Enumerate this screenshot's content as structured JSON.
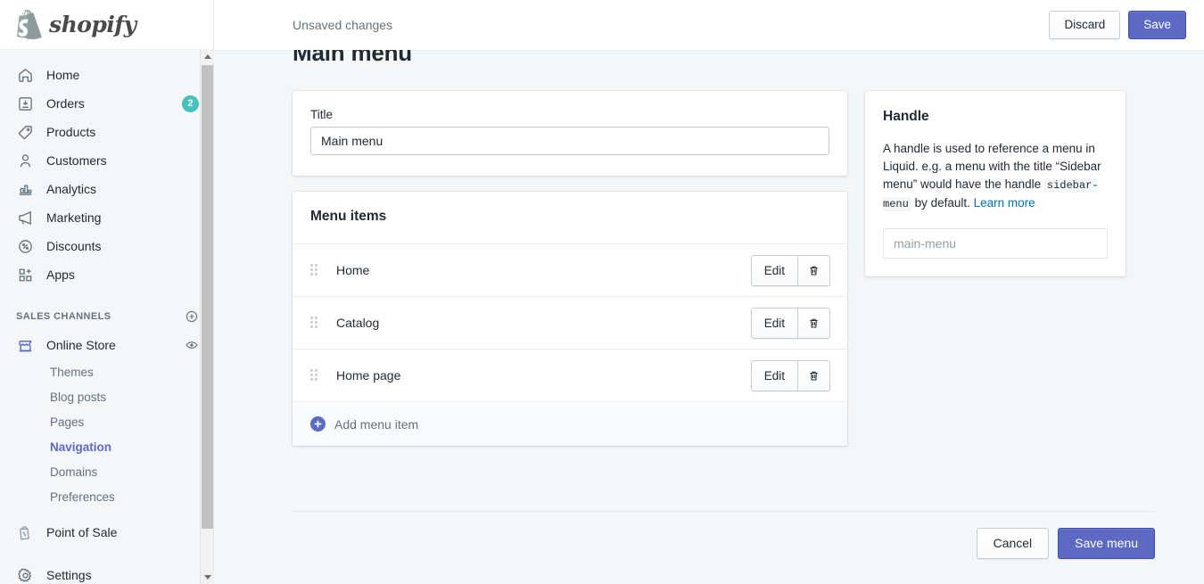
{
  "brand": {
    "name": "shopify",
    "accent": "#5c6ac4",
    "badge_color": "#47c1bf",
    "link_color": "#006fbb"
  },
  "sidebar": {
    "primary": [
      {
        "label": "Home",
        "icon": "home-icon",
        "badge": ""
      },
      {
        "label": "Orders",
        "icon": "orders-icon",
        "badge": "2"
      },
      {
        "label": "Products",
        "icon": "products-tag-icon",
        "badge": ""
      },
      {
        "label": "Customers",
        "icon": "customers-person-icon",
        "badge": ""
      },
      {
        "label": "Analytics",
        "icon": "analytics-bars-icon",
        "badge": ""
      },
      {
        "label": "Marketing",
        "icon": "marketing-megaphone-icon",
        "badge": ""
      },
      {
        "label": "Discounts",
        "icon": "discounts-percent-icon",
        "badge": ""
      },
      {
        "label": "Apps",
        "icon": "apps-grid-plus-icon",
        "badge": ""
      }
    ],
    "section_title": "SALES CHANNELS",
    "channel": {
      "label": "Online Store",
      "icon": "storefront-icon",
      "trailing_icon": "eye-icon"
    },
    "sub_items": [
      {
        "label": "Themes",
        "active": false
      },
      {
        "label": "Blog posts",
        "active": false
      },
      {
        "label": "Pages",
        "active": false
      },
      {
        "label": "Navigation",
        "active": true
      },
      {
        "label": "Domains",
        "active": false
      },
      {
        "label": "Preferences",
        "active": false
      }
    ],
    "point_of_sale": {
      "label": "Point of Sale",
      "icon": "pos-bag-icon"
    },
    "settings": {
      "label": "Settings",
      "icon": "gear-icon"
    }
  },
  "topbar": {
    "status": "Unsaved changes",
    "discard_label": "Discard",
    "save_label": "Save"
  },
  "page": {
    "title": "Main menu"
  },
  "title_card": {
    "label": "Title",
    "value": "Main menu",
    "placeholder": "Title"
  },
  "menu_card": {
    "heading": "Menu items",
    "items": [
      {
        "name": "Home",
        "edit_label": "Edit",
        "delete_icon": "trash-icon"
      },
      {
        "name": "Catalog",
        "edit_label": "Edit",
        "delete_icon": "trash-icon"
      },
      {
        "name": "Home page",
        "edit_label": "Edit",
        "delete_icon": "trash-icon"
      }
    ],
    "add_label": "Add menu item",
    "add_icon": "plus-circle-icon"
  },
  "handle_card": {
    "heading": "Handle",
    "body_part1": "A handle is used to reference a menu in Liquid. e.g. a menu with the title “Sidebar menu” would have the handle ",
    "code": "sidebar-menu",
    "body_part2": " by default. ",
    "learn_more": "Learn more",
    "input_value": "",
    "input_placeholder": "main-menu"
  },
  "footer": {
    "cancel_label": "Cancel",
    "save_label": "Save menu"
  }
}
